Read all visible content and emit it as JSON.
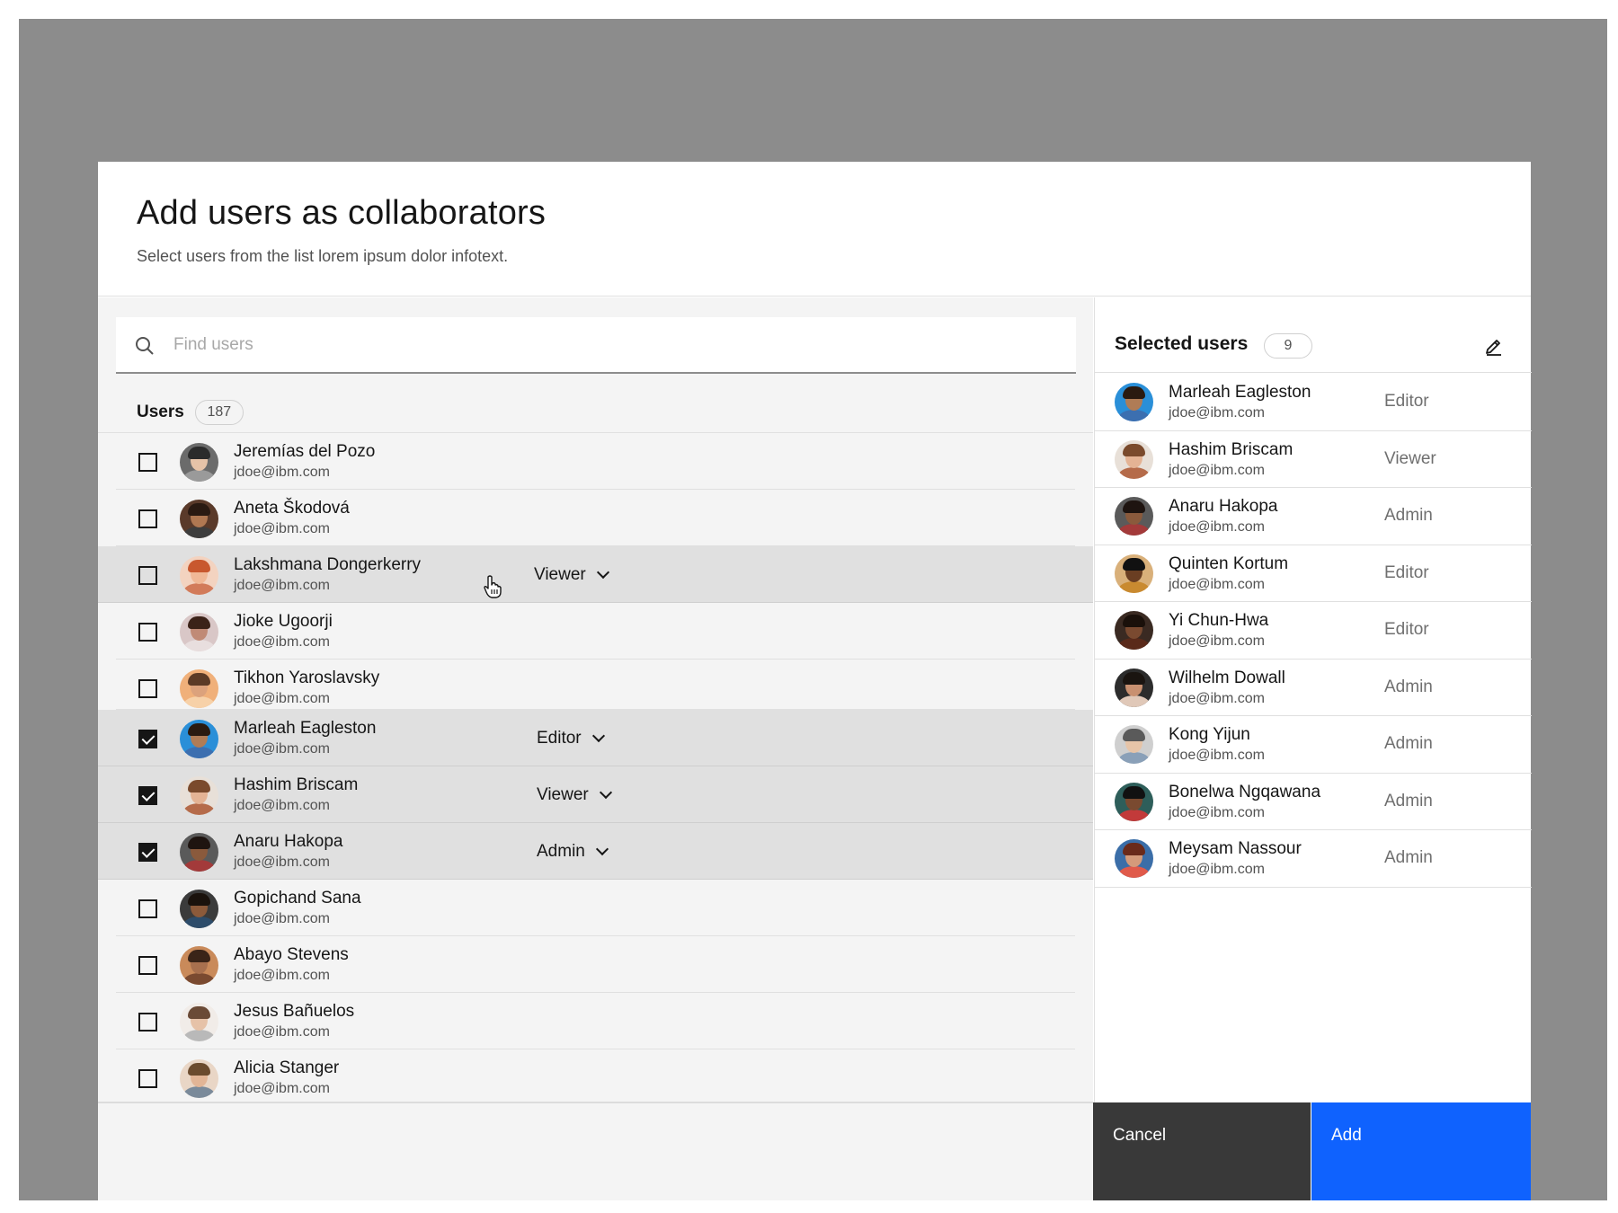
{
  "modal": {
    "title": "Add users as collaborators",
    "subtitle": "Select users from the list lorem ipsum dolor infotext."
  },
  "search": {
    "placeholder": "Find users",
    "value": ""
  },
  "users": {
    "label": "Users",
    "count": "187",
    "rows": [
      {
        "name": "Jeremías del Pozo",
        "email": "jdoe@ibm.com",
        "checked": false,
        "role": ""
      },
      {
        "name": "Aneta Škodová",
        "email": "jdoe@ibm.com",
        "checked": false,
        "role": ""
      },
      {
        "name": "Lakshmana Dongerkerry",
        "email": "jdoe@ibm.com",
        "checked": false,
        "role": "Viewer"
      },
      {
        "name": "Jioke Ugoorji",
        "email": "jdoe@ibm.com",
        "checked": false,
        "role": ""
      },
      {
        "name": "Tikhon Yaroslavsky",
        "email": "jdoe@ibm.com",
        "checked": false,
        "role": ""
      },
      {
        "name": "Marleah Eagleston",
        "email": "jdoe@ibm.com",
        "checked": true,
        "role": "Editor"
      },
      {
        "name": "Hashim Briscam",
        "email": "jdoe@ibm.com",
        "checked": true,
        "role": "Viewer"
      },
      {
        "name": "Anaru Hakopa",
        "email": "jdoe@ibm.com",
        "checked": true,
        "role": "Admin"
      },
      {
        "name": "Gopichand Sana",
        "email": "jdoe@ibm.com",
        "checked": false,
        "role": ""
      },
      {
        "name": "Abayo Stevens",
        "email": "jdoe@ibm.com",
        "checked": false,
        "role": ""
      },
      {
        "name": "Jesus Bañuelos",
        "email": "jdoe@ibm.com",
        "checked": false,
        "role": ""
      },
      {
        "name": "Alicia Stanger",
        "email": "jdoe@ibm.com",
        "checked": false,
        "role": ""
      }
    ]
  },
  "selected": {
    "title": "Selected users",
    "count": "9",
    "rows": [
      {
        "name": "Marleah Eagleston",
        "email": "jdoe@ibm.com",
        "role": "Editor"
      },
      {
        "name": "Hashim Briscam",
        "email": "jdoe@ibm.com",
        "role": "Viewer"
      },
      {
        "name": "Anaru Hakopa",
        "email": "jdoe@ibm.com",
        "role": "Admin"
      },
      {
        "name": "Quinten Kortum",
        "email": "jdoe@ibm.com",
        "role": "Editor"
      },
      {
        "name": "Yi Chun-Hwa",
        "email": "jdoe@ibm.com",
        "role": "Editor"
      },
      {
        "name": "Wilhelm Dowall",
        "email": "jdoe@ibm.com",
        "role": "Admin"
      },
      {
        "name": "Kong Yijun",
        "email": "jdoe@ibm.com",
        "role": "Admin"
      },
      {
        "name": "Bonelwa Ngqawana",
        "email": "jdoe@ibm.com",
        "role": "Admin"
      },
      {
        "name": "Meysam Nassour",
        "email": "jdoe@ibm.com",
        "role": "Admin"
      }
    ]
  },
  "buttons": {
    "cancel": "Cancel",
    "add": "Add"
  },
  "colors": {
    "primary": "#0f62fe",
    "secondary": "#393939",
    "overlay": "#8c8c8c",
    "row_highlight": "#e0e0e0"
  },
  "icons": {
    "search": "search-icon",
    "edit": "edit-icon",
    "checkbox_checked": "checkbox-checked-icon",
    "checkbox_unchecked": "checkbox-unchecked-icon",
    "chevron": "chevron-down-icon",
    "cursor": "hand-pointer-icon"
  }
}
